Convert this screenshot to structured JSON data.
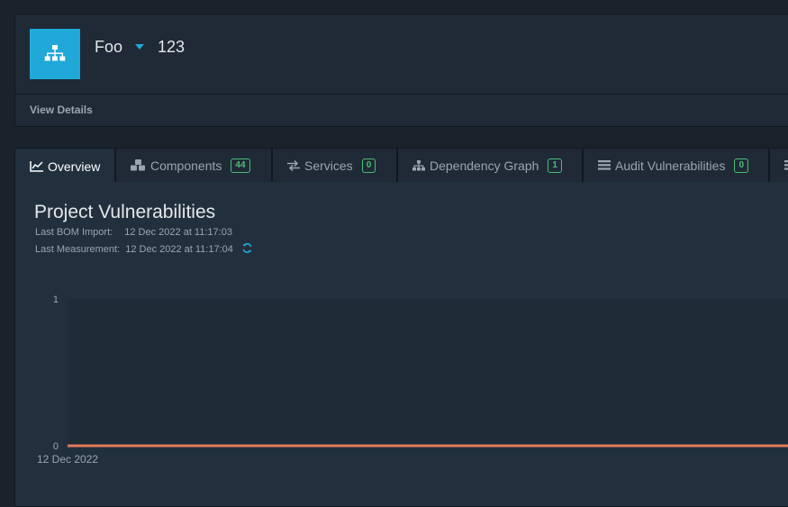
{
  "project": {
    "name": "Foo",
    "version": "123",
    "view_details_label": "View Details"
  },
  "tabs": [
    {
      "label": "Overview",
      "icon": "line-chart-icon"
    },
    {
      "label": "Components",
      "icon": "cubes-icon",
      "count": "44"
    },
    {
      "label": "Services",
      "icon": "exchange-icon",
      "count": "0"
    },
    {
      "label": "Dependency Graph",
      "icon": "sitemap-icon",
      "count": "1"
    },
    {
      "label": "Audit Vulnerabilities",
      "icon": "tasks-icon",
      "count": "0"
    }
  ],
  "overview": {
    "title": "Project Vulnerabilities",
    "last_bom_import_label": "Last BOM Import:",
    "last_bom_import_value": "12 Dec 2022 at 11:17:03",
    "last_measurement_label": "Last Measurement:",
    "last_measurement_value": "12 Dec 2022 at 11:17:04"
  },
  "colors": {
    "accent": "#20a8d8",
    "badge": "#4dbd74",
    "series": "#e3795a"
  },
  "chart_data": {
    "type": "line",
    "x": [
      "12 Dec 2022"
    ],
    "series": [
      {
        "values": [
          0
        ]
      }
    ],
    "ylim": [
      0,
      1
    ],
    "y_ticks": [
      "1",
      "0"
    ],
    "x_tick_labels": [
      "12 Dec 2022"
    ],
    "title": "",
    "xlabel": "",
    "ylabel": ""
  }
}
